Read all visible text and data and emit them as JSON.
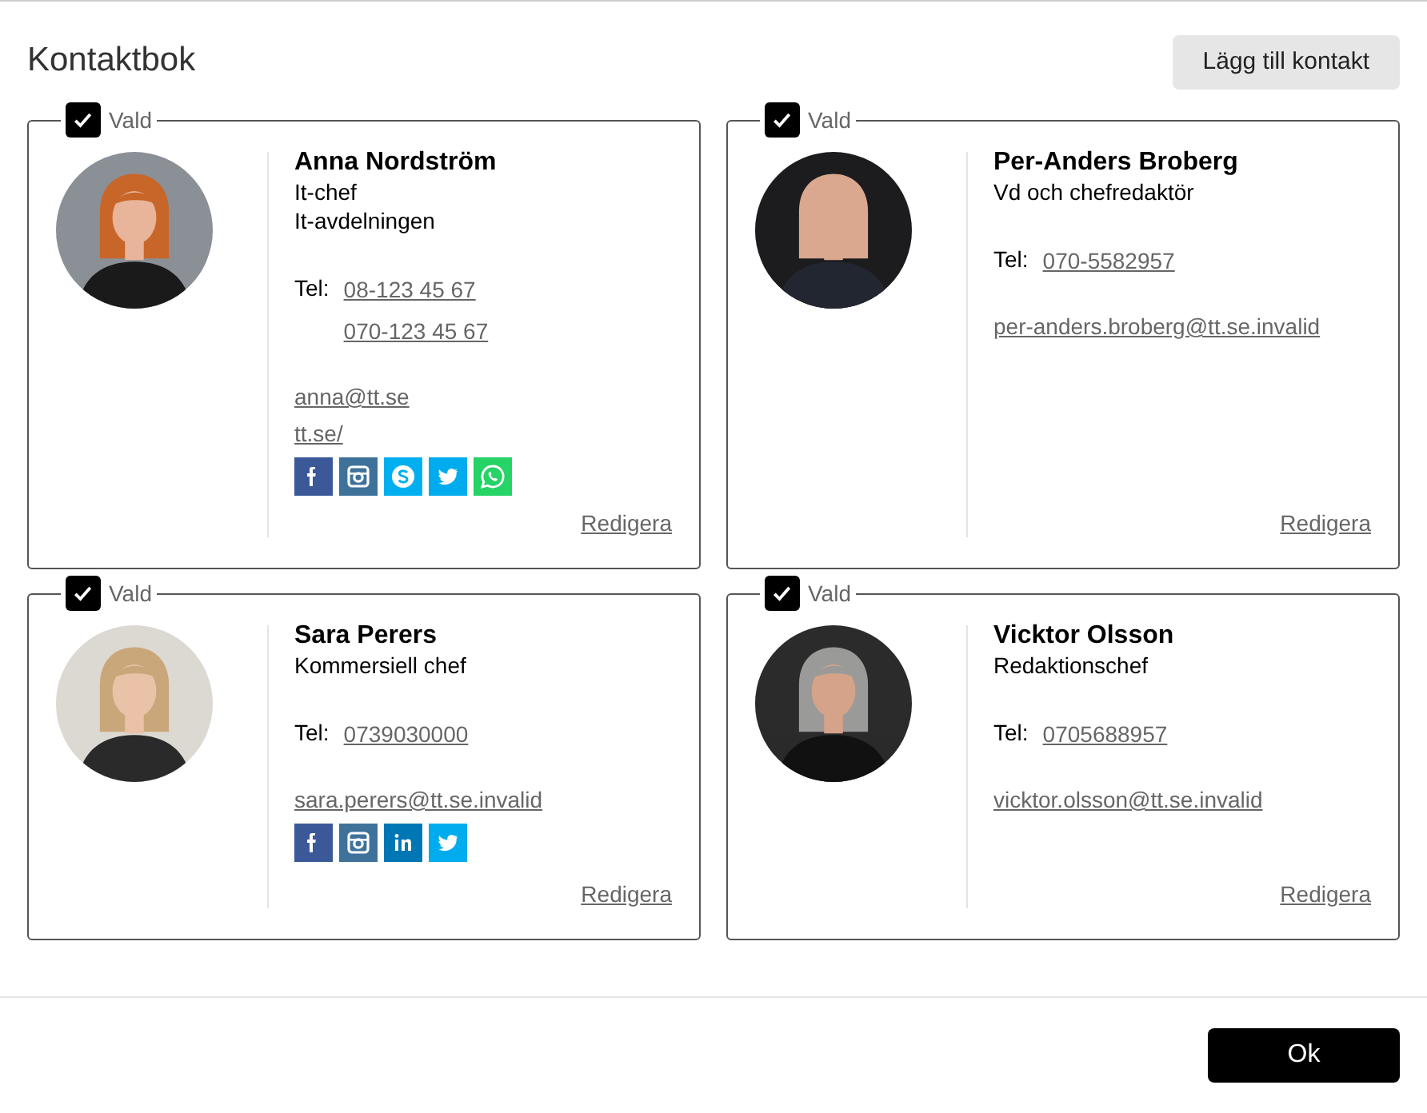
{
  "title": "Kontaktbok",
  "add_button": "Lägg till kontakt",
  "contacts": [
    {
      "selected_label": "Vald",
      "checked": true,
      "name": "Anna Nordström",
      "title": "It-chef",
      "department": "It-avdelningen",
      "tel_label": "Tel:",
      "phones": [
        "08-123 45 67",
        "070-123 45 67"
      ],
      "email": "anna@tt.se",
      "website": "tt.se/",
      "social": [
        {
          "kind": "facebook"
        },
        {
          "kind": "instagram"
        },
        {
          "kind": "skype"
        },
        {
          "kind": "twitter"
        },
        {
          "kind": "whatsapp"
        }
      ],
      "edit": "Redigera"
    },
    {
      "selected_label": "Vald",
      "checked": true,
      "name": "Per-Anders Broberg",
      "title": "Vd och chefredaktör",
      "tel_label": "Tel:",
      "phones": [
        "070-5582957"
      ],
      "email": "per-anders.broberg@tt.se.invalid",
      "edit": "Redigera"
    },
    {
      "selected_label": "Vald",
      "checked": true,
      "name": "Sara Perers",
      "title": "Kommersiell chef",
      "tel_label": "Tel:",
      "phones": [
        "0739030000"
      ],
      "email": "sara.perers@tt.se.invalid",
      "social": [
        {
          "kind": "facebook"
        },
        {
          "kind": "instagram"
        },
        {
          "kind": "linkedin"
        },
        {
          "kind": "twitter"
        }
      ],
      "edit": "Redigera"
    },
    {
      "selected_label": "Vald",
      "checked": true,
      "name": "Vicktor Olsson",
      "title": "Redaktionschef",
      "tel_label": "Tel:",
      "phones": [
        "0705688957"
      ],
      "email": "vicktor.olsson@tt.se.invalid",
      "edit": "Redigera"
    }
  ],
  "ok_button": "Ok"
}
